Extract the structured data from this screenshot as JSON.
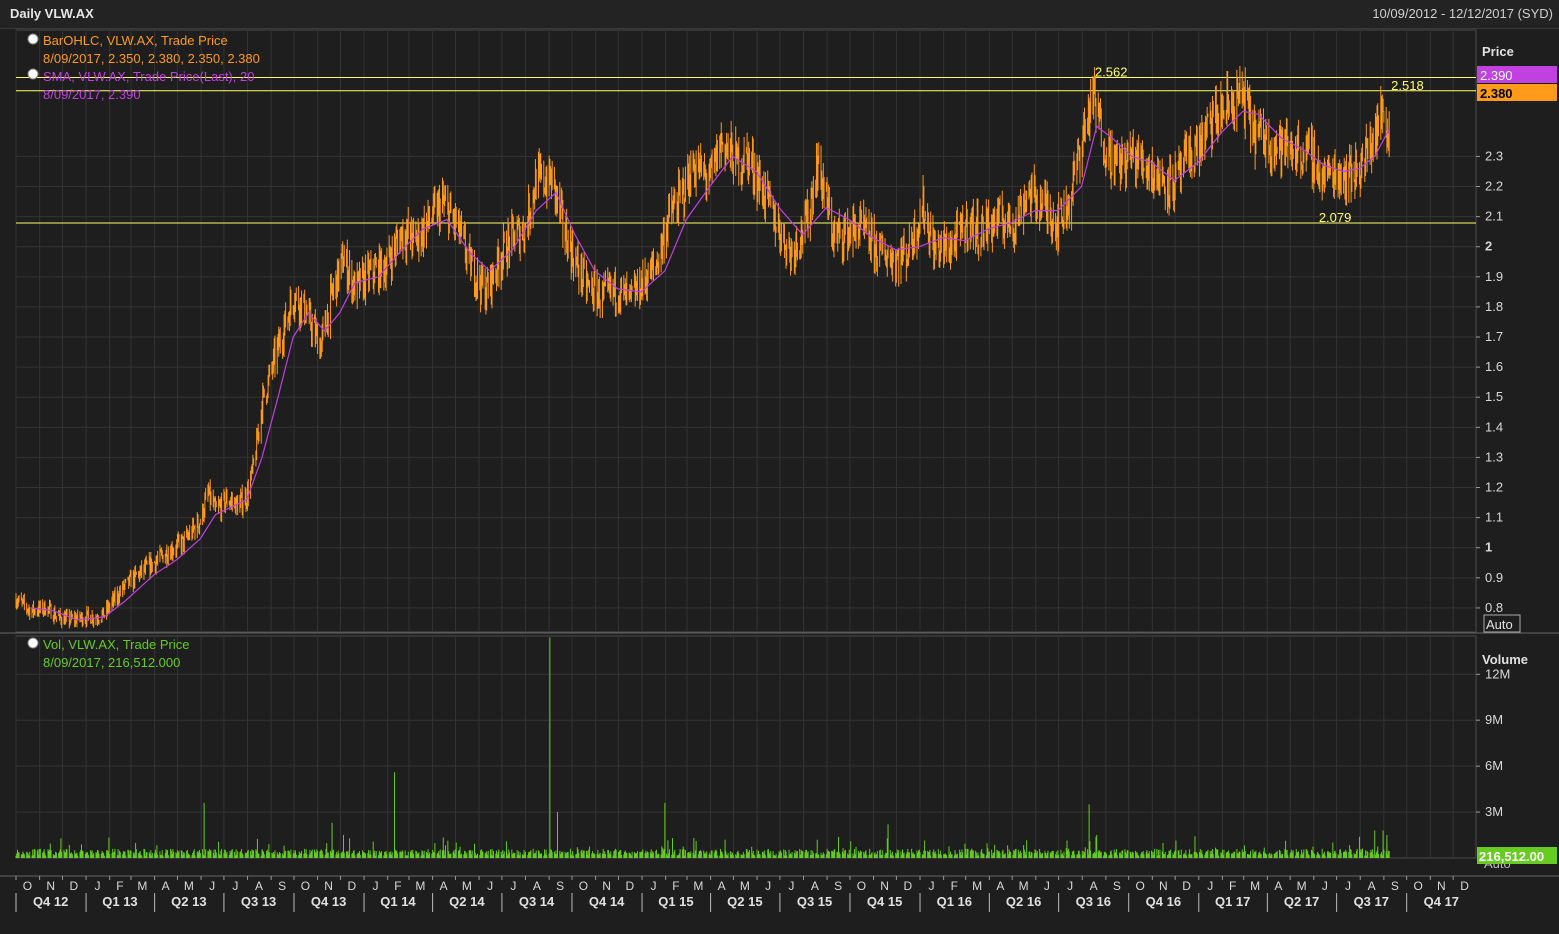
{
  "header": {
    "title": "Daily VLW.AX",
    "date_range": "10/09/2012 - 12/12/2017 (SYD)"
  },
  "colors": {
    "background": "#1e1e1e",
    "price_bars": "#ff9a1a",
    "sma": "#c040e0",
    "volume": "#66cc22",
    "hlines": "#ffff66",
    "grid": "#333333"
  },
  "price_legend": {
    "ohlc_title": "BarOHLC, VLW.AX, Trade Price",
    "ohlc_values": "8/09/2017, 2.350, 2.380, 2.350, 2.380",
    "sma_title": "SMA, VLW.AX, Trade Price(Last),  20",
    "sma_values": "8/09/2017, 2.390"
  },
  "volume_legend": {
    "title": "Vol, VLW.AX, Trade Price",
    "values": "8/09/2017, 216,512.000"
  },
  "price_axis": {
    "label": "Price",
    "auto": "Auto",
    "sma_tag": "2.390",
    "last_tag": "2.380"
  },
  "volume_axis": {
    "label": "Volume",
    "auto": "Auto",
    "last_tag": "216,512.00"
  },
  "chart_data": {
    "type": "line",
    "xlim": [
      "2012-10-01",
      "2017-12-31"
    ],
    "price_ylim": [
      0.72,
      2.72
    ],
    "price_ticks": [
      0.8,
      0.9,
      1,
      1.1,
      1.2,
      1.3,
      1.4,
      1.5,
      1.6,
      1.7,
      1.8,
      1.9,
      2,
      2.1,
      2.2,
      2.3
    ],
    "volume_ylim": [
      0,
      14500000
    ],
    "volume_ticks": [
      3000000,
      6000000,
      9000000,
      12000000
    ],
    "volume_tick_labels": [
      "3M",
      "6M",
      "9M",
      "12M"
    ],
    "horizontal_lines": [
      {
        "value": 2.562,
        "label": "2.562",
        "date": "2016-08-15"
      },
      {
        "value": 2.518,
        "label": "2.518",
        "date": "2017-09-08"
      },
      {
        "value": 2.079,
        "label": "2.079",
        "date": "2017-06-05"
      }
    ],
    "price_series": {
      "name": "BarOHLC, VLW.AX, Trade Price",
      "points": [
        [
          "2012-10-01",
          0.83
        ],
        [
          "2012-10-20",
          0.79
        ],
        [
          "2012-11-10",
          0.8
        ],
        [
          "2012-11-25",
          0.77
        ],
        [
          "2012-12-10",
          0.76
        ],
        [
          "2012-12-31",
          0.77
        ],
        [
          "2013-01-15",
          0.77
        ],
        [
          "2013-01-25",
          0.78
        ],
        [
          "2013-02-05",
          0.82
        ],
        [
          "2013-02-20",
          0.87
        ],
        [
          "2013-03-10",
          0.91
        ],
        [
          "2013-03-31",
          0.95
        ],
        [
          "2013-04-20",
          0.99
        ],
        [
          "2013-05-10",
          1.02
        ],
        [
          "2013-05-31",
          1.09
        ],
        [
          "2013-06-10",
          1.18
        ],
        [
          "2013-06-20",
          1.12
        ],
        [
          "2013-07-05",
          1.16
        ],
        [
          "2013-07-20",
          1.14
        ],
        [
          "2013-07-31",
          1.17
        ],
        [
          "2013-08-10",
          1.28
        ],
        [
          "2013-08-20",
          1.48
        ],
        [
          "2013-09-05",
          1.62
        ],
        [
          "2013-09-20",
          1.75
        ],
        [
          "2013-10-01",
          1.84
        ],
        [
          "2013-10-15",
          1.79
        ],
        [
          "2013-11-05",
          1.67
        ],
        [
          "2013-11-20",
          1.84
        ],
        [
          "2013-12-05",
          1.96
        ],
        [
          "2013-12-20",
          1.86
        ],
        [
          "2014-01-10",
          1.91
        ],
        [
          "2014-01-31",
          1.94
        ],
        [
          "2014-02-20",
          2.05
        ],
        [
          "2014-03-10",
          2.02
        ],
        [
          "2014-03-31",
          2.1
        ],
        [
          "2014-04-15",
          2.14
        ],
        [
          "2014-05-05",
          2.06
        ],
        [
          "2014-05-20",
          1.94
        ],
        [
          "2014-06-10",
          1.85
        ],
        [
          "2014-06-30",
          1.97
        ],
        [
          "2014-07-15",
          2.03
        ],
        [
          "2014-07-31",
          2.06
        ],
        [
          "2014-08-15",
          2.22
        ],
        [
          "2014-09-05",
          2.22
        ],
        [
          "2014-09-20",
          2.06
        ],
        [
          "2014-10-05",
          1.95
        ],
        [
          "2014-10-20",
          1.87
        ],
        [
          "2014-11-10",
          1.83
        ],
        [
          "2014-11-30",
          1.86
        ],
        [
          "2014-12-15",
          1.82
        ],
        [
          "2015-01-05",
          1.89
        ],
        [
          "2015-01-20",
          1.94
        ],
        [
          "2015-02-05",
          2.1
        ],
        [
          "2015-02-20",
          2.16
        ],
        [
          "2015-03-10",
          2.27
        ],
        [
          "2015-03-31",
          2.22
        ],
        [
          "2015-04-15",
          2.35
        ],
        [
          "2015-05-05",
          2.28
        ],
        [
          "2015-05-20",
          2.3
        ],
        [
          "2015-06-10",
          2.18
        ],
        [
          "2015-06-30",
          2.06
        ],
        [
          "2015-07-15",
          1.98
        ],
        [
          "2015-08-05",
          2.08
        ],
        [
          "2015-08-20",
          2.28
        ],
        [
          "2015-09-10",
          2.03
        ],
        [
          "2015-09-30",
          2.05
        ],
        [
          "2015-10-15",
          2.06
        ],
        [
          "2015-11-05",
          1.99
        ],
        [
          "2015-11-30",
          1.96
        ],
        [
          "2015-12-15",
          1.98
        ],
        [
          "2016-01-05",
          2.13
        ],
        [
          "2016-01-20",
          1.99
        ],
        [
          "2016-02-10",
          2.0
        ],
        [
          "2016-03-05",
          2.08
        ],
        [
          "2016-03-20",
          2.05
        ],
        [
          "2016-04-10",
          2.09
        ],
        [
          "2016-05-05",
          2.08
        ],
        [
          "2016-05-20",
          2.18
        ],
        [
          "2016-06-10",
          2.14
        ],
        [
          "2016-06-30",
          2.08
        ],
        [
          "2016-07-15",
          2.15
        ],
        [
          "2016-07-31",
          2.35
        ],
        [
          "2016-08-15",
          2.5
        ],
        [
          "2016-08-31",
          2.34
        ],
        [
          "2016-09-15",
          2.27
        ],
        [
          "2016-10-05",
          2.3
        ],
        [
          "2016-10-20",
          2.28
        ],
        [
          "2016-11-10",
          2.23
        ],
        [
          "2016-11-30",
          2.21
        ],
        [
          "2016-12-15",
          2.28
        ],
        [
          "2017-01-05",
          2.35
        ],
        [
          "2017-01-20",
          2.42
        ],
        [
          "2017-02-10",
          2.47
        ],
        [
          "2017-02-28",
          2.5
        ],
        [
          "2017-03-15",
          2.38
        ],
        [
          "2017-04-05",
          2.35
        ],
        [
          "2017-04-20",
          2.33
        ],
        [
          "2017-05-10",
          2.32
        ],
        [
          "2017-05-31",
          2.3
        ],
        [
          "2017-06-10",
          2.23
        ],
        [
          "2017-06-30",
          2.25
        ],
        [
          "2017-07-20",
          2.24
        ],
        [
          "2017-08-05",
          2.28
        ],
        [
          "2017-08-15",
          2.34
        ],
        [
          "2017-08-31",
          2.45
        ],
        [
          "2017-09-08",
          2.38
        ]
      ]
    },
    "sma_series": {
      "name": "SMA, VLW.AX, Trade Price(Last),  20",
      "points": [
        [
          "2012-10-20",
          0.8
        ],
        [
          "2012-11-20",
          0.79
        ],
        [
          "2012-12-20",
          0.76
        ],
        [
          "2013-01-25",
          0.77
        ],
        [
          "2013-02-20",
          0.82
        ],
        [
          "2013-03-31",
          0.91
        ],
        [
          "2013-04-30",
          0.96
        ],
        [
          "2013-05-31",
          1.03
        ],
        [
          "2013-06-20",
          1.11
        ],
        [
          "2013-07-15",
          1.14
        ],
        [
          "2013-07-31",
          1.16
        ],
        [
          "2013-08-20",
          1.3
        ],
        [
          "2013-09-10",
          1.5
        ],
        [
          "2013-09-30",
          1.7
        ],
        [
          "2013-10-20",
          1.78
        ],
        [
          "2013-11-10",
          1.72
        ],
        [
          "2013-11-30",
          1.78
        ],
        [
          "2013-12-20",
          1.88
        ],
        [
          "2014-01-20",
          1.9
        ],
        [
          "2014-02-20",
          1.99
        ],
        [
          "2014-03-20",
          2.06
        ],
        [
          "2014-04-20",
          2.09
        ],
        [
          "2014-05-20",
          1.98
        ],
        [
          "2014-06-15",
          1.92
        ],
        [
          "2014-07-15",
          1.99
        ],
        [
          "2014-08-15",
          2.12
        ],
        [
          "2014-09-10",
          2.18
        ],
        [
          "2014-10-05",
          2.04
        ],
        [
          "2014-10-31",
          1.92
        ],
        [
          "2014-11-30",
          1.86
        ],
        [
          "2014-12-31",
          1.85
        ],
        [
          "2015-01-31",
          1.92
        ],
        [
          "2015-02-28",
          2.09
        ],
        [
          "2015-03-31",
          2.2
        ],
        [
          "2015-04-30",
          2.3
        ],
        [
          "2015-05-31",
          2.25
        ],
        [
          "2015-06-30",
          2.13
        ],
        [
          "2015-07-31",
          2.04
        ],
        [
          "2015-08-31",
          2.13
        ],
        [
          "2015-09-30",
          2.09
        ],
        [
          "2015-10-31",
          2.03
        ],
        [
          "2015-11-30",
          1.99
        ],
        [
          "2015-12-31",
          2.0
        ],
        [
          "2016-01-31",
          2.03
        ],
        [
          "2016-02-29",
          2.02
        ],
        [
          "2016-03-31",
          2.06
        ],
        [
          "2016-04-30",
          2.08
        ],
        [
          "2016-05-31",
          2.12
        ],
        [
          "2016-06-30",
          2.12
        ],
        [
          "2016-07-31",
          2.2
        ],
        [
          "2016-08-20",
          2.4
        ],
        [
          "2016-09-10",
          2.36
        ],
        [
          "2016-10-05",
          2.3
        ],
        [
          "2016-10-31",
          2.28
        ],
        [
          "2016-11-30",
          2.22
        ],
        [
          "2016-12-31",
          2.28
        ],
        [
          "2017-01-31",
          2.38
        ],
        [
          "2017-02-28",
          2.45
        ],
        [
          "2017-03-20",
          2.44
        ],
        [
          "2017-04-20",
          2.36
        ],
        [
          "2017-05-20",
          2.32
        ],
        [
          "2017-06-15",
          2.27
        ],
        [
          "2017-07-10",
          2.25
        ],
        [
          "2017-07-31",
          2.26
        ],
        [
          "2017-08-20",
          2.3
        ],
        [
          "2017-09-08",
          2.39
        ]
      ]
    },
    "volume_spikes": [
      [
        "2013-06-05",
        3600000
      ],
      [
        "2013-12-05",
        1500000
      ],
      [
        "2013-11-20",
        2300000
      ],
      [
        "2014-02-10",
        5600000
      ],
      [
        "2014-09-02",
        14400000
      ],
      [
        "2014-09-12",
        3000000
      ],
      [
        "2015-01-31",
        3600000
      ],
      [
        "2015-02-10",
        1300000
      ],
      [
        "2015-04-20",
        1200000
      ],
      [
        "2015-11-20",
        2200000
      ],
      [
        "2016-08-10",
        3500000
      ],
      [
        "2016-08-20",
        1500000
      ],
      [
        "2017-08-20",
        1800000
      ],
      [
        "2017-08-31",
        1800000
      ],
      [
        "2017-09-05",
        1500000
      ]
    ],
    "x_month_labels": [
      "O",
      "N",
      "D",
      "J",
      "F",
      "M",
      "A",
      "M",
      "J",
      "J",
      "A",
      "S",
      "O",
      "N",
      "D",
      "J",
      "F",
      "M",
      "A",
      "M",
      "J",
      "J",
      "A",
      "S",
      "O",
      "N",
      "D",
      "J",
      "F",
      "M",
      "A",
      "M",
      "J",
      "J",
      "A",
      "S",
      "O",
      "N",
      "D",
      "J",
      "F",
      "M",
      "A",
      "M",
      "J",
      "J",
      "A",
      "S",
      "O",
      "N",
      "D",
      "J",
      "F",
      "M",
      "A",
      "M",
      "J",
      "J",
      "A",
      "S",
      "O",
      "N",
      "D"
    ],
    "x_quarter_labels": [
      "Q4 12",
      "Q1 13",
      "Q2 13",
      "Q3 13",
      "Q4 13",
      "Q1 14",
      "Q2 14",
      "Q3 14",
      "Q4 14",
      "Q1 15",
      "Q2 15",
      "Q3 15",
      "Q4 15",
      "Q1 16",
      "Q2 16",
      "Q3 16",
      "Q4 16",
      "Q1 17",
      "Q2 17",
      "Q3 17",
      "Q4 17"
    ]
  }
}
